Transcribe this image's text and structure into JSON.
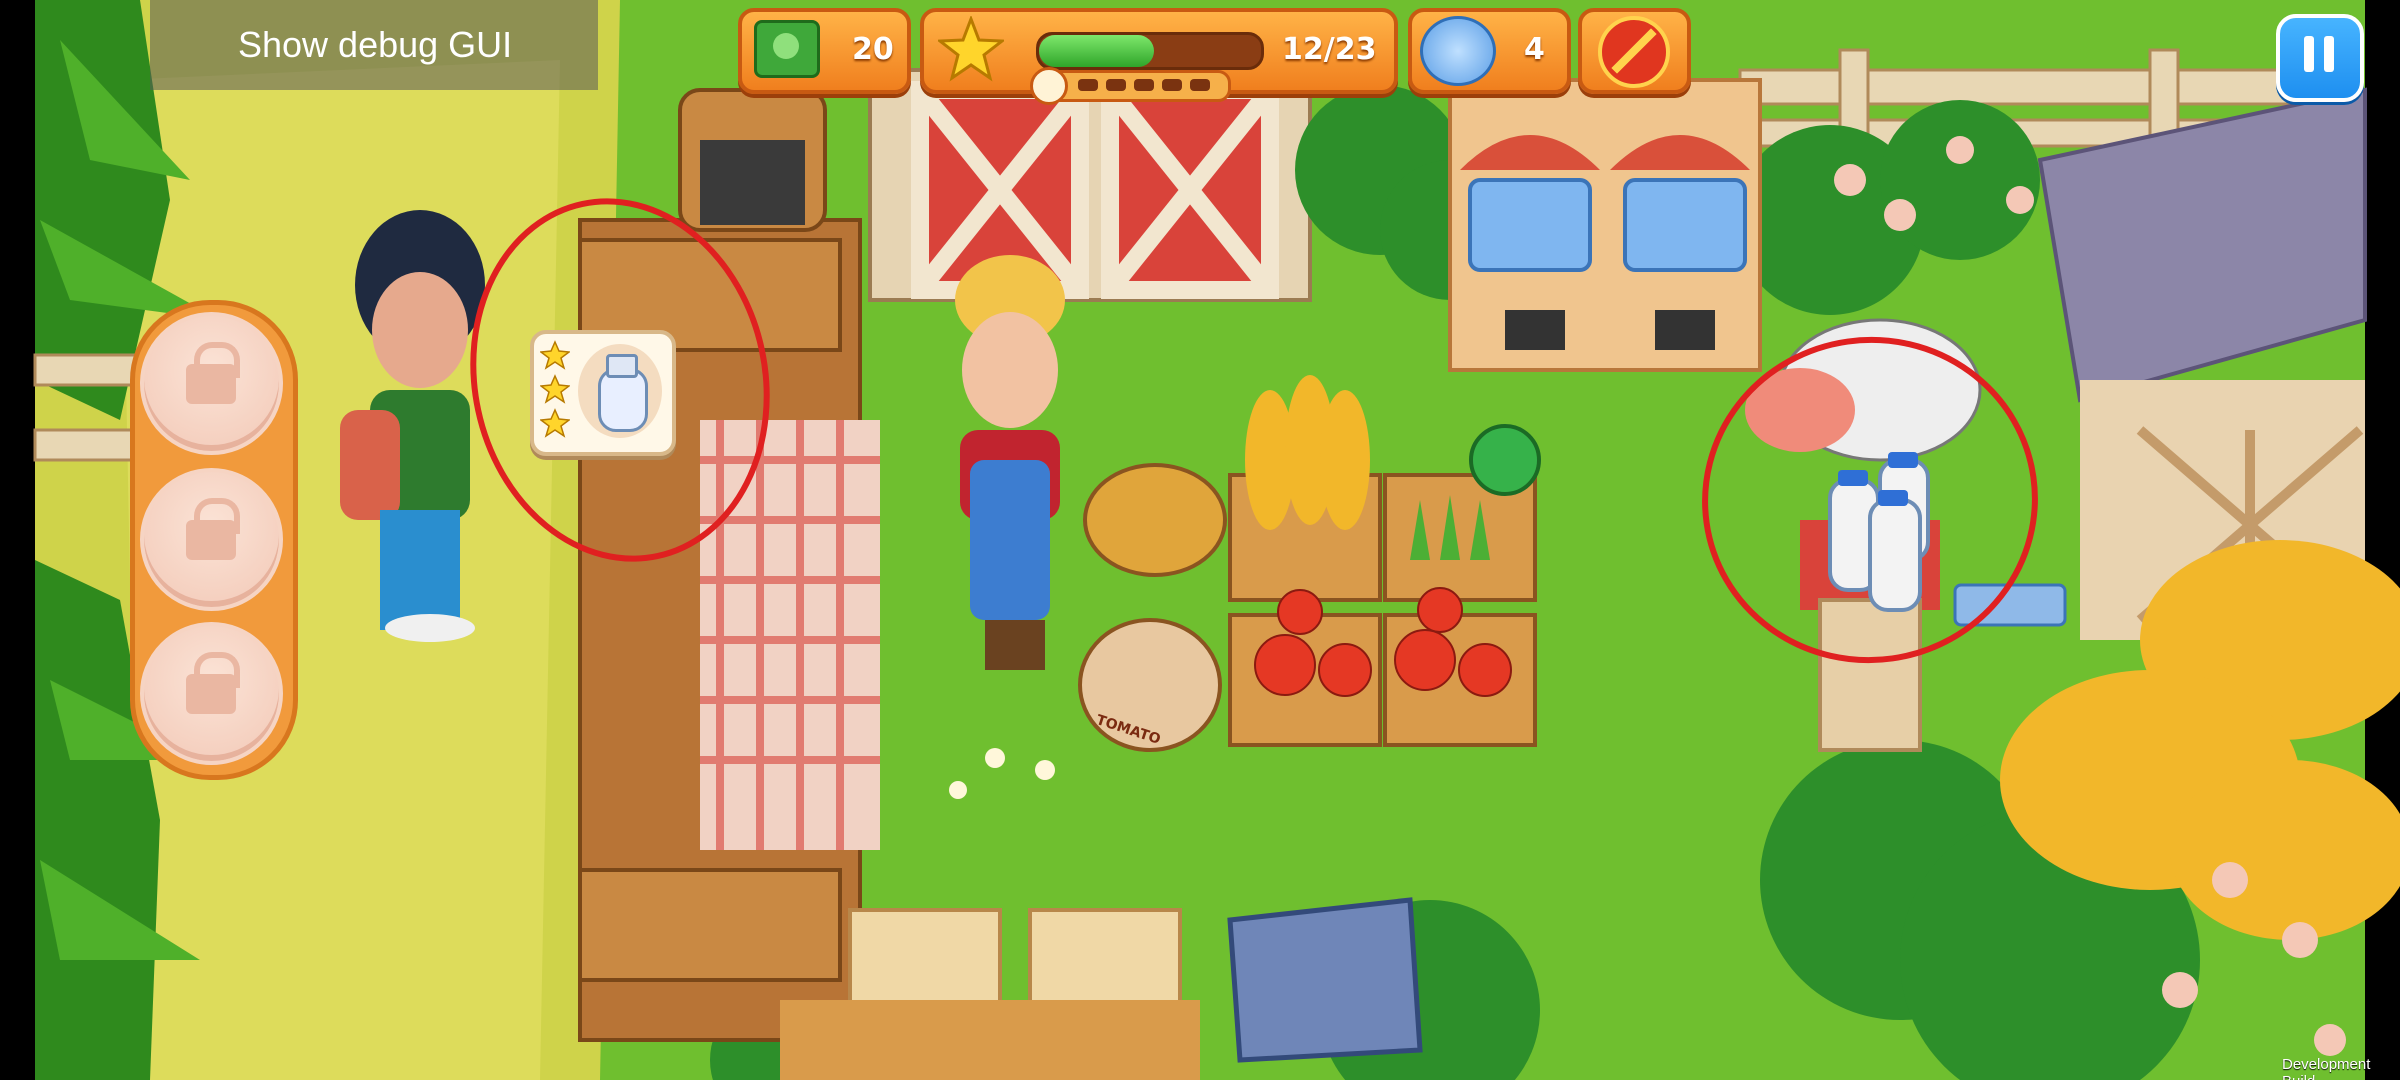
{
  "debug": {
    "label": "Show debug GUI"
  },
  "hud": {
    "money": "20",
    "level_progress_text": "12/23",
    "level_progress_fraction": 0.52,
    "gems": "4",
    "pause_icon": "pause-icon"
  },
  "footer": {
    "build_label": "Development Build"
  },
  "sack_label": "TOMATO",
  "order": {
    "stars": 3,
    "item_icon": "milk-jug-icon"
  },
  "colors": {
    "hud_orange": "#f07f1e",
    "hud_border": "#c85a12",
    "progress_green": "#3fc23a",
    "pause_blue": "#1e8ff0",
    "grass": "#6fbf2f",
    "annotation_red": "#e02020"
  }
}
